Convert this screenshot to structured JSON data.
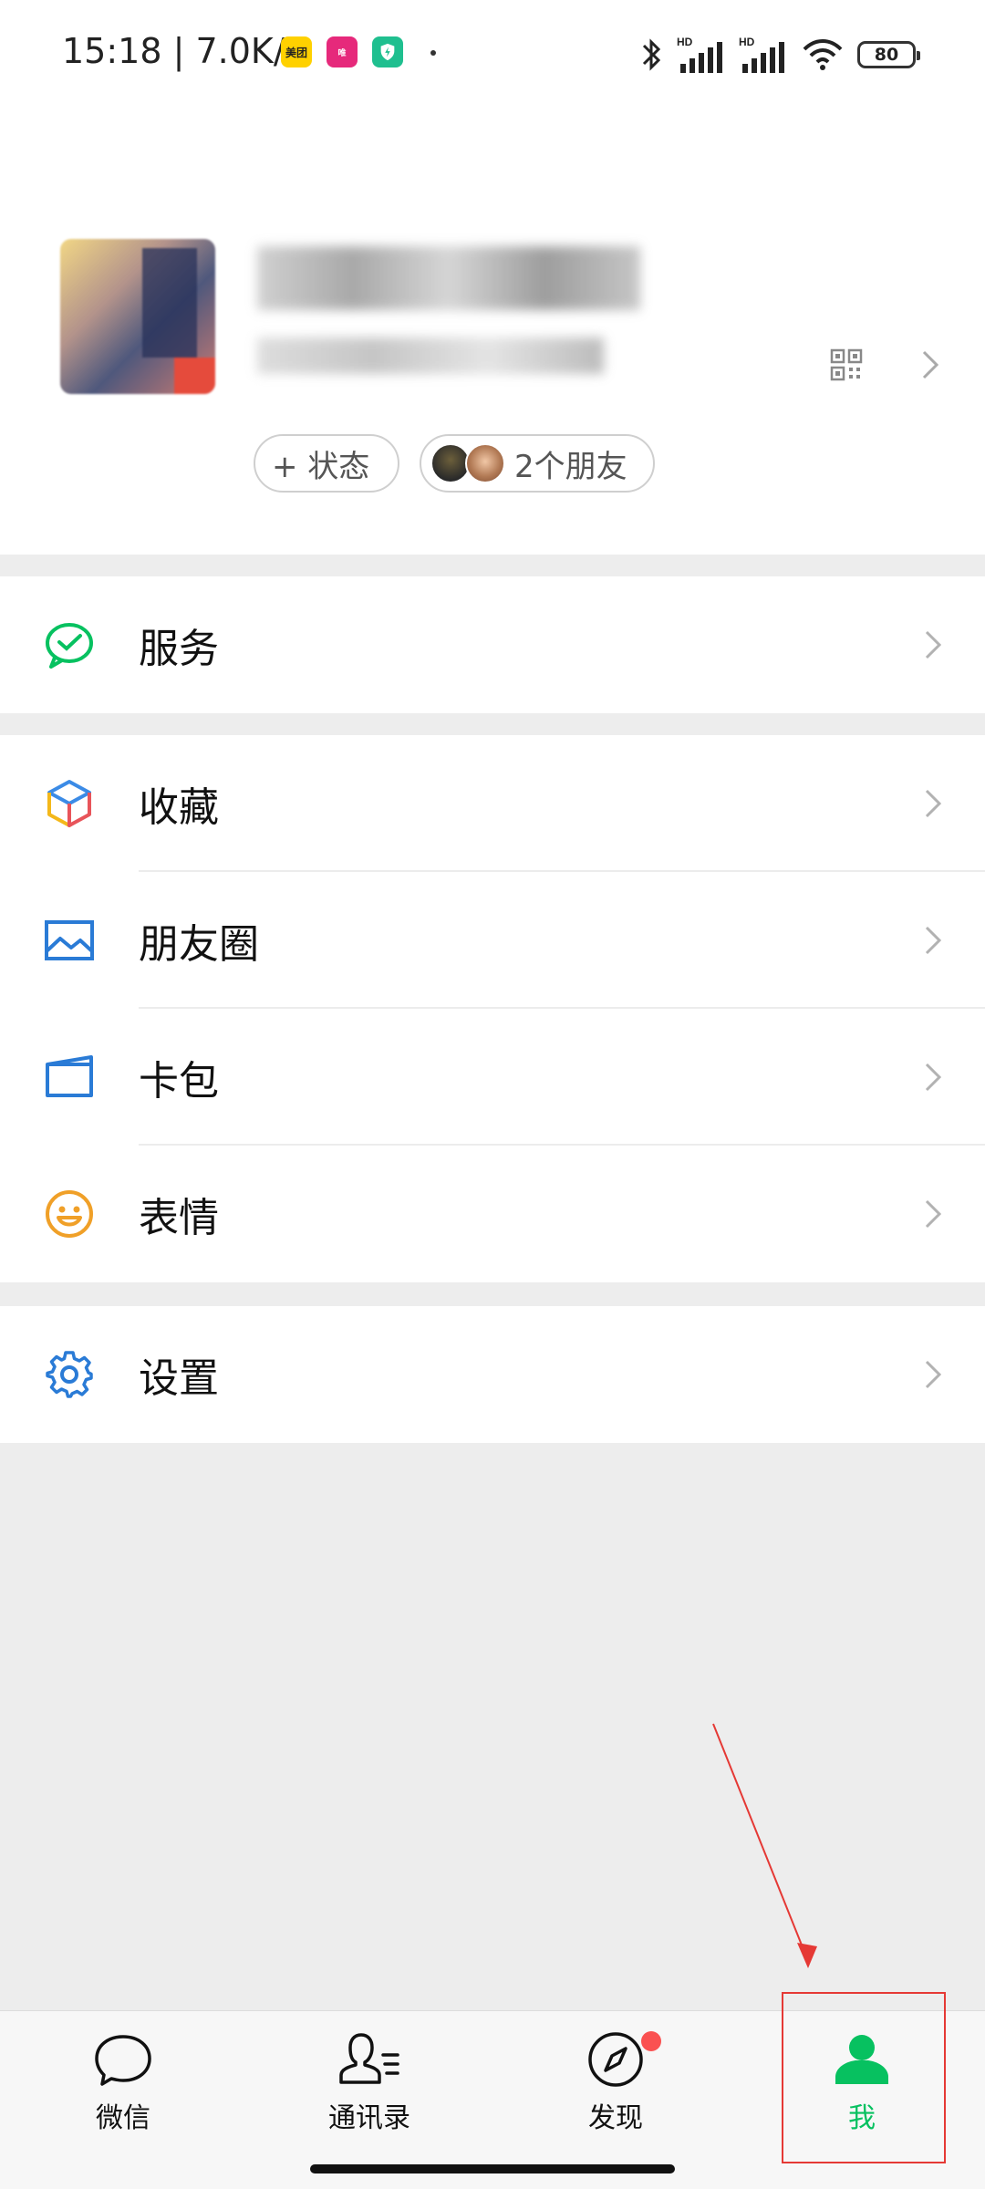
{
  "status_bar": {
    "time_speed": "15:18 | 7.0K/s",
    "app_icons": [
      {
        "name": "meituan",
        "label": "美团",
        "color": "#ffd100"
      },
      {
        "name": "vipshop",
        "label": "唯品会",
        "color": "#e6297b"
      },
      {
        "name": "security",
        "label": "",
        "color": "#1fbf8f"
      }
    ],
    "battery": "80"
  },
  "profile": {
    "add_status_label": "+ 状态",
    "friends_label": "2个朋友"
  },
  "menu": {
    "service": {
      "label": "服务",
      "icon": "wechat-pay-icon",
      "color": "#07c160"
    },
    "group": [
      {
        "label": "收藏",
        "icon": "favorites-cube-icon"
      },
      {
        "label": "朋友圈",
        "icon": "moments-picture-icon",
        "color": "#2a7bd6"
      },
      {
        "label": "卡包",
        "icon": "card-wallet-icon",
        "color": "#2a7bd6"
      },
      {
        "label": "表情",
        "icon": "smiley-icon",
        "color": "#f0a028"
      }
    ],
    "settings": {
      "label": "设置",
      "icon": "gear-icon",
      "color": "#2a7bd6"
    }
  },
  "tabbar": {
    "tabs": [
      {
        "label": "微信",
        "icon": "chat-bubble-icon",
        "active": false
      },
      {
        "label": "通讯录",
        "icon": "contacts-icon",
        "active": false
      },
      {
        "label": "发现",
        "icon": "compass-icon",
        "active": false,
        "badge": true
      },
      {
        "label": "我",
        "icon": "person-icon",
        "active": true
      }
    ],
    "active_color": "#07c160"
  }
}
